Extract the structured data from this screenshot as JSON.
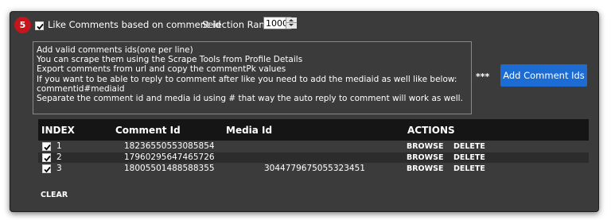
{
  "step_number": "5",
  "options": {
    "like_label": "Like Comments based on comment id",
    "like_checked": true,
    "rank_label": "Selection Rank",
    "rank_value": "1000"
  },
  "instructions": [
    "Add valid comments ids(one per line)",
    " You can scrape them using the Scrape Tools from Profile Details",
    " Export comments from url and copy the commentPk values",
    " If you want to be able to reply to comment after like you need to add the mediaid as well like below:",
    " commentid#mediaid",
    " Separate the comment id and media id using # that way the auto reply to comment will work as well."
  ],
  "stars": "***",
  "add_button_label": "Add Comment Ids",
  "table": {
    "headers": {
      "index": "INDEX",
      "comment_id": "Comment Id",
      "media_id": "Media Id",
      "actions": "ACTIONS"
    },
    "rows": [
      {
        "index": "1",
        "comment_id": "18236550553085854",
        "media_id": "",
        "browse": "BROWSE",
        "delete": "DELETE",
        "checked": true
      },
      {
        "index": "2",
        "comment_id": "17960295647465726",
        "media_id": "",
        "browse": "BROWSE",
        "delete": "DELETE",
        "checked": true
      },
      {
        "index": "3",
        "comment_id": "18005501488588355",
        "media_id": "3044779675055323451",
        "browse": "BROWSE",
        "delete": "DELETE",
        "checked": true
      }
    ]
  },
  "clear_label": "CLEAR",
  "colors": {
    "panel": "#3b3b3b",
    "accent_button": "#1c6cd3",
    "step_badge": "#c4161c",
    "header_bg": "#151515"
  }
}
